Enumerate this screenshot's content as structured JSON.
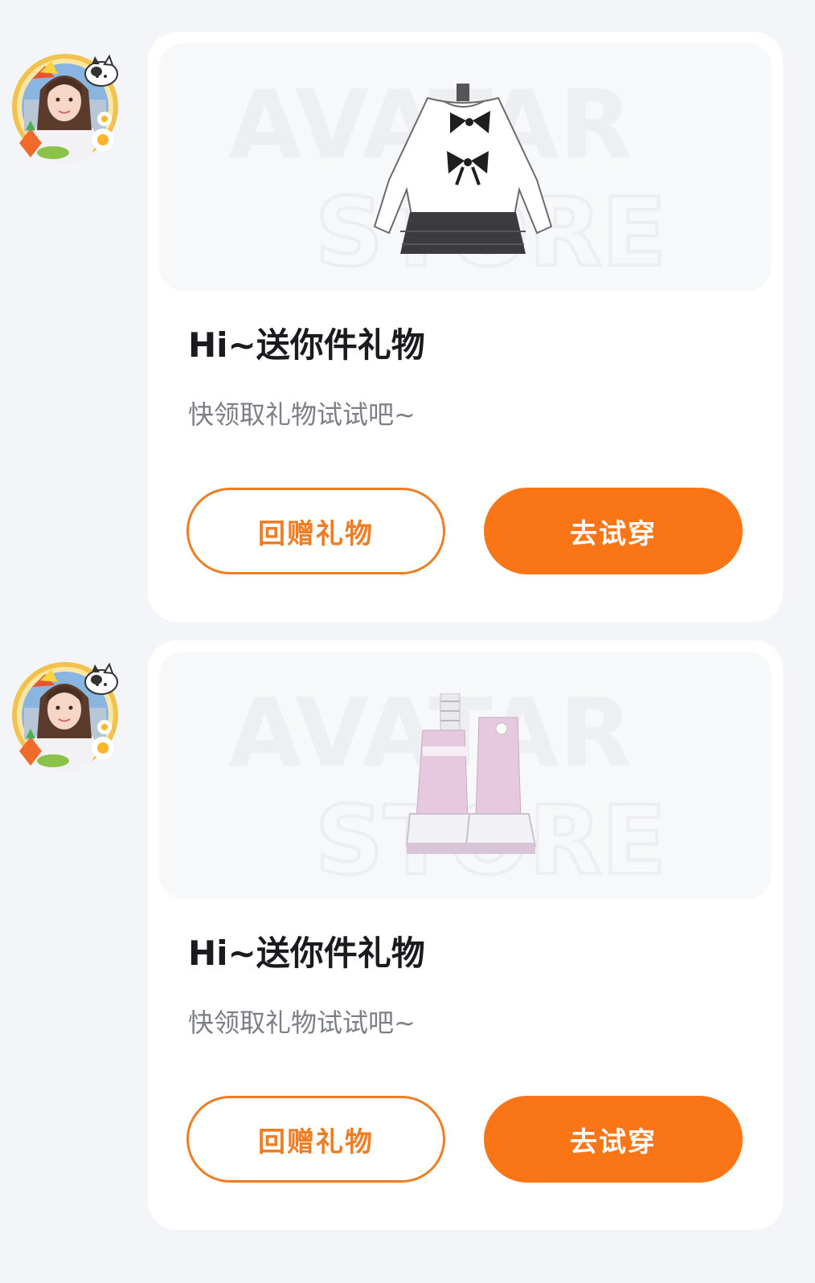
{
  "colors": {
    "page_background": "#f3f5f8",
    "card_background": "#ffffff",
    "accent": "#fa7516",
    "accent_outline": "#ef7d24",
    "title_text": "#1b1b1f",
    "subtitle_text": "#7d7f86"
  },
  "messages": [
    {
      "item_icon": "sweater-skirt-outfit",
      "title": "Hi~送你件礼物",
      "subtitle": "快领取礼物试试吧~",
      "return_gift_label": "回赠礼物",
      "try_on_label": "去试穿"
    },
    {
      "item_icon": "pink-boots",
      "title": "Hi~送你件礼物",
      "subtitle": "快领取礼物试试吧~",
      "return_gift_label": "回赠礼物",
      "try_on_label": "去试穿"
    }
  ]
}
